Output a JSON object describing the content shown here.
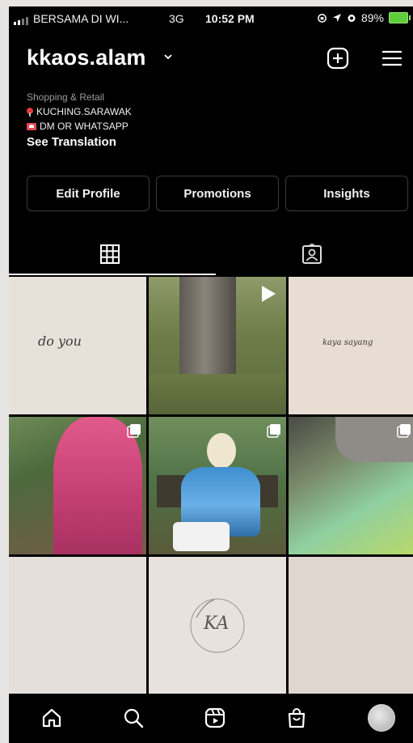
{
  "status_bar": {
    "carrier": "BERSAMA DI WI...",
    "network": "3G",
    "time": "10:52 PM",
    "battery": "89%"
  },
  "profile": {
    "username": "kkaos.alam",
    "category": "Shopping & Retail",
    "location": "KUCHING.SARAWAK",
    "contact": "DM OR WHATSAPP",
    "see_translation": "See Translation"
  },
  "actions": {
    "edit_profile": "Edit Profile",
    "promotions": "Promotions",
    "insights": "Insights"
  },
  "posts": [
    {
      "kind": "text",
      "text": "do you"
    },
    {
      "kind": "reel"
    },
    {
      "kind": "text",
      "text": "kaya sayang"
    },
    {
      "kind": "carousel"
    },
    {
      "kind": "carousel"
    },
    {
      "kind": "carousel"
    },
    {
      "kind": "blank"
    },
    {
      "kind": "logo",
      "text": "KA"
    },
    {
      "kind": "blank"
    }
  ],
  "colors": {
    "background": "#000000",
    "button_border": "#3a3a3a",
    "battery": "#5fcf3a"
  },
  "icons": [
    "add-post-icon",
    "menu-icon",
    "grid-icon",
    "tagged-icon",
    "home-icon",
    "search-icon",
    "reels-icon",
    "shop-icon"
  ]
}
